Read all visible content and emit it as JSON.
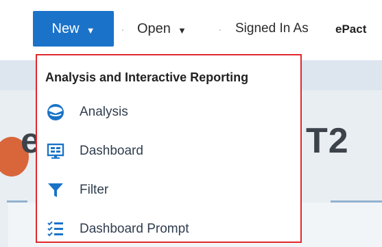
{
  "toolbar": {
    "new_label": "New",
    "open_label": "Open",
    "signed_in_label": "Signed In As",
    "user_name": "ePact"
  },
  "background": {
    "heading_left": "e",
    "heading_right": "T2"
  },
  "menu": {
    "header": "Analysis and Interactive Reporting",
    "items": [
      {
        "label": "Analysis",
        "icon": "analysis-icon"
      },
      {
        "label": "Dashboard",
        "icon": "dashboard-icon"
      },
      {
        "label": "Filter",
        "icon": "filter-icon"
      },
      {
        "label": "Dashboard Prompt",
        "icon": "dashboard-prompt-icon"
      }
    ]
  },
  "colors": {
    "accent": "#1b72c9",
    "highlight_border": "#e0262b",
    "icon_blue": "#1a73c7"
  }
}
